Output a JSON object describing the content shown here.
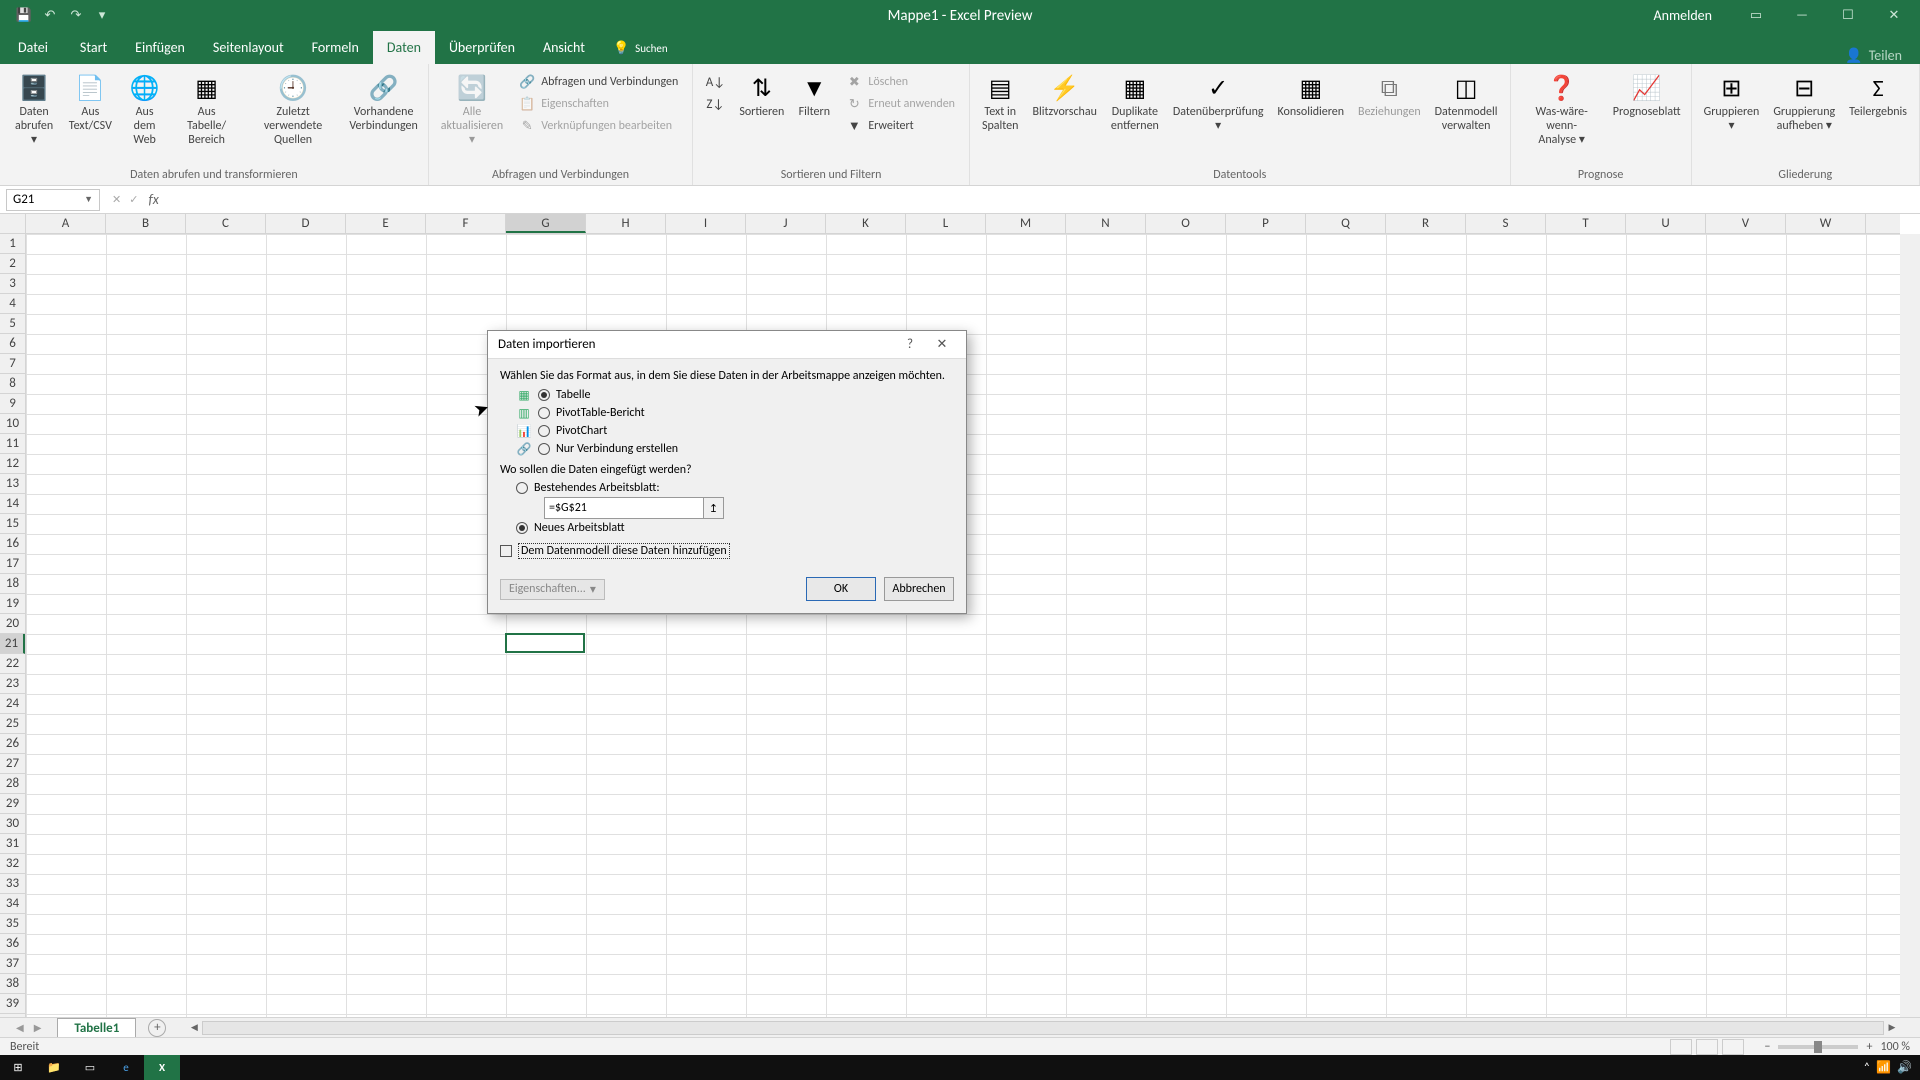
{
  "title": "Mappe1  -  Excel Preview",
  "signin": "Anmelden",
  "tabs": {
    "file": "Datei",
    "list": [
      "Start",
      "Einfügen",
      "Seitenlayout",
      "Formeln",
      "Daten",
      "Überprüfen",
      "Ansicht"
    ],
    "active": "Daten",
    "search": "Suchen",
    "share": "Teilen"
  },
  "ribbon": {
    "group1": {
      "items": [
        "Daten\nabrufen ▾",
        "Aus\nText/CSV",
        "Aus dem\nWeb",
        "Aus Tabelle/\nBereich",
        "Zuletzt verwendete\nQuellen",
        "Vorhandene\nVerbindungen"
      ],
      "label": "Daten abrufen und transformieren"
    },
    "group2": {
      "big": "Alle\naktualisieren ▾",
      "small": [
        "Abfragen und Verbindungen",
        "Eigenschaften",
        "Verknüpfungen bearbeiten"
      ],
      "label": "Abfragen und Verbindungen"
    },
    "group3": {
      "sort": "Sortieren",
      "filter": "Filtern",
      "small": [
        "Löschen",
        "Erneut anwenden",
        "Erweitert"
      ],
      "label": "Sortieren und Filtern"
    },
    "group4": {
      "items": [
        "Text in\nSpalten",
        "Blitzvorschau",
        "Duplikate\nentfernen",
        "Datenüberprüfung\n▾",
        "Konsolidieren",
        "Beziehungen",
        "Datenmodell\nverwalten"
      ],
      "label": "Datentools"
    },
    "group5": {
      "items": [
        "Was-wäre-wenn-\nAnalyse ▾",
        "Prognoseblatt"
      ],
      "label": "Prognose"
    },
    "group6": {
      "items": [
        "Gruppieren\n▾",
        "Gruppierung\naufheben ▾",
        "Teilergebnis"
      ],
      "label": "Gliederung"
    }
  },
  "namebox": "G21",
  "columns": [
    "A",
    "B",
    "C",
    "D",
    "E",
    "F",
    "G",
    "H",
    "I",
    "J",
    "K",
    "L",
    "M",
    "N",
    "O",
    "P",
    "Q",
    "R",
    "S",
    "T",
    "U",
    "V",
    "W"
  ],
  "selected_col": "G",
  "selected_row": 21,
  "rows": 39,
  "sheet": "Tabelle1",
  "status": "Bereit",
  "zoom": "100 %",
  "dialog": {
    "title": "Daten importieren",
    "instruction": "Wählen Sie das Format aus, in dem Sie diese Daten in der Arbeitsmappe anzeigen möchten.",
    "opt_table": "Tabelle",
    "opt_pivot": "PivotTable-Bericht",
    "opt_chart": "PivotChart",
    "opt_conn": "Nur Verbindung erstellen",
    "where": "Wo sollen die Daten eingefügt werden?",
    "where_existing": "Bestehendes Arbeitsblatt:",
    "where_range": "=$G$21",
    "where_new": "Neues Arbeitsblatt",
    "add_model": "Dem Datenmodell diese Daten hinzufügen",
    "properties": "Eigenschaften...",
    "ok": "OK",
    "cancel": "Abbrechen"
  }
}
